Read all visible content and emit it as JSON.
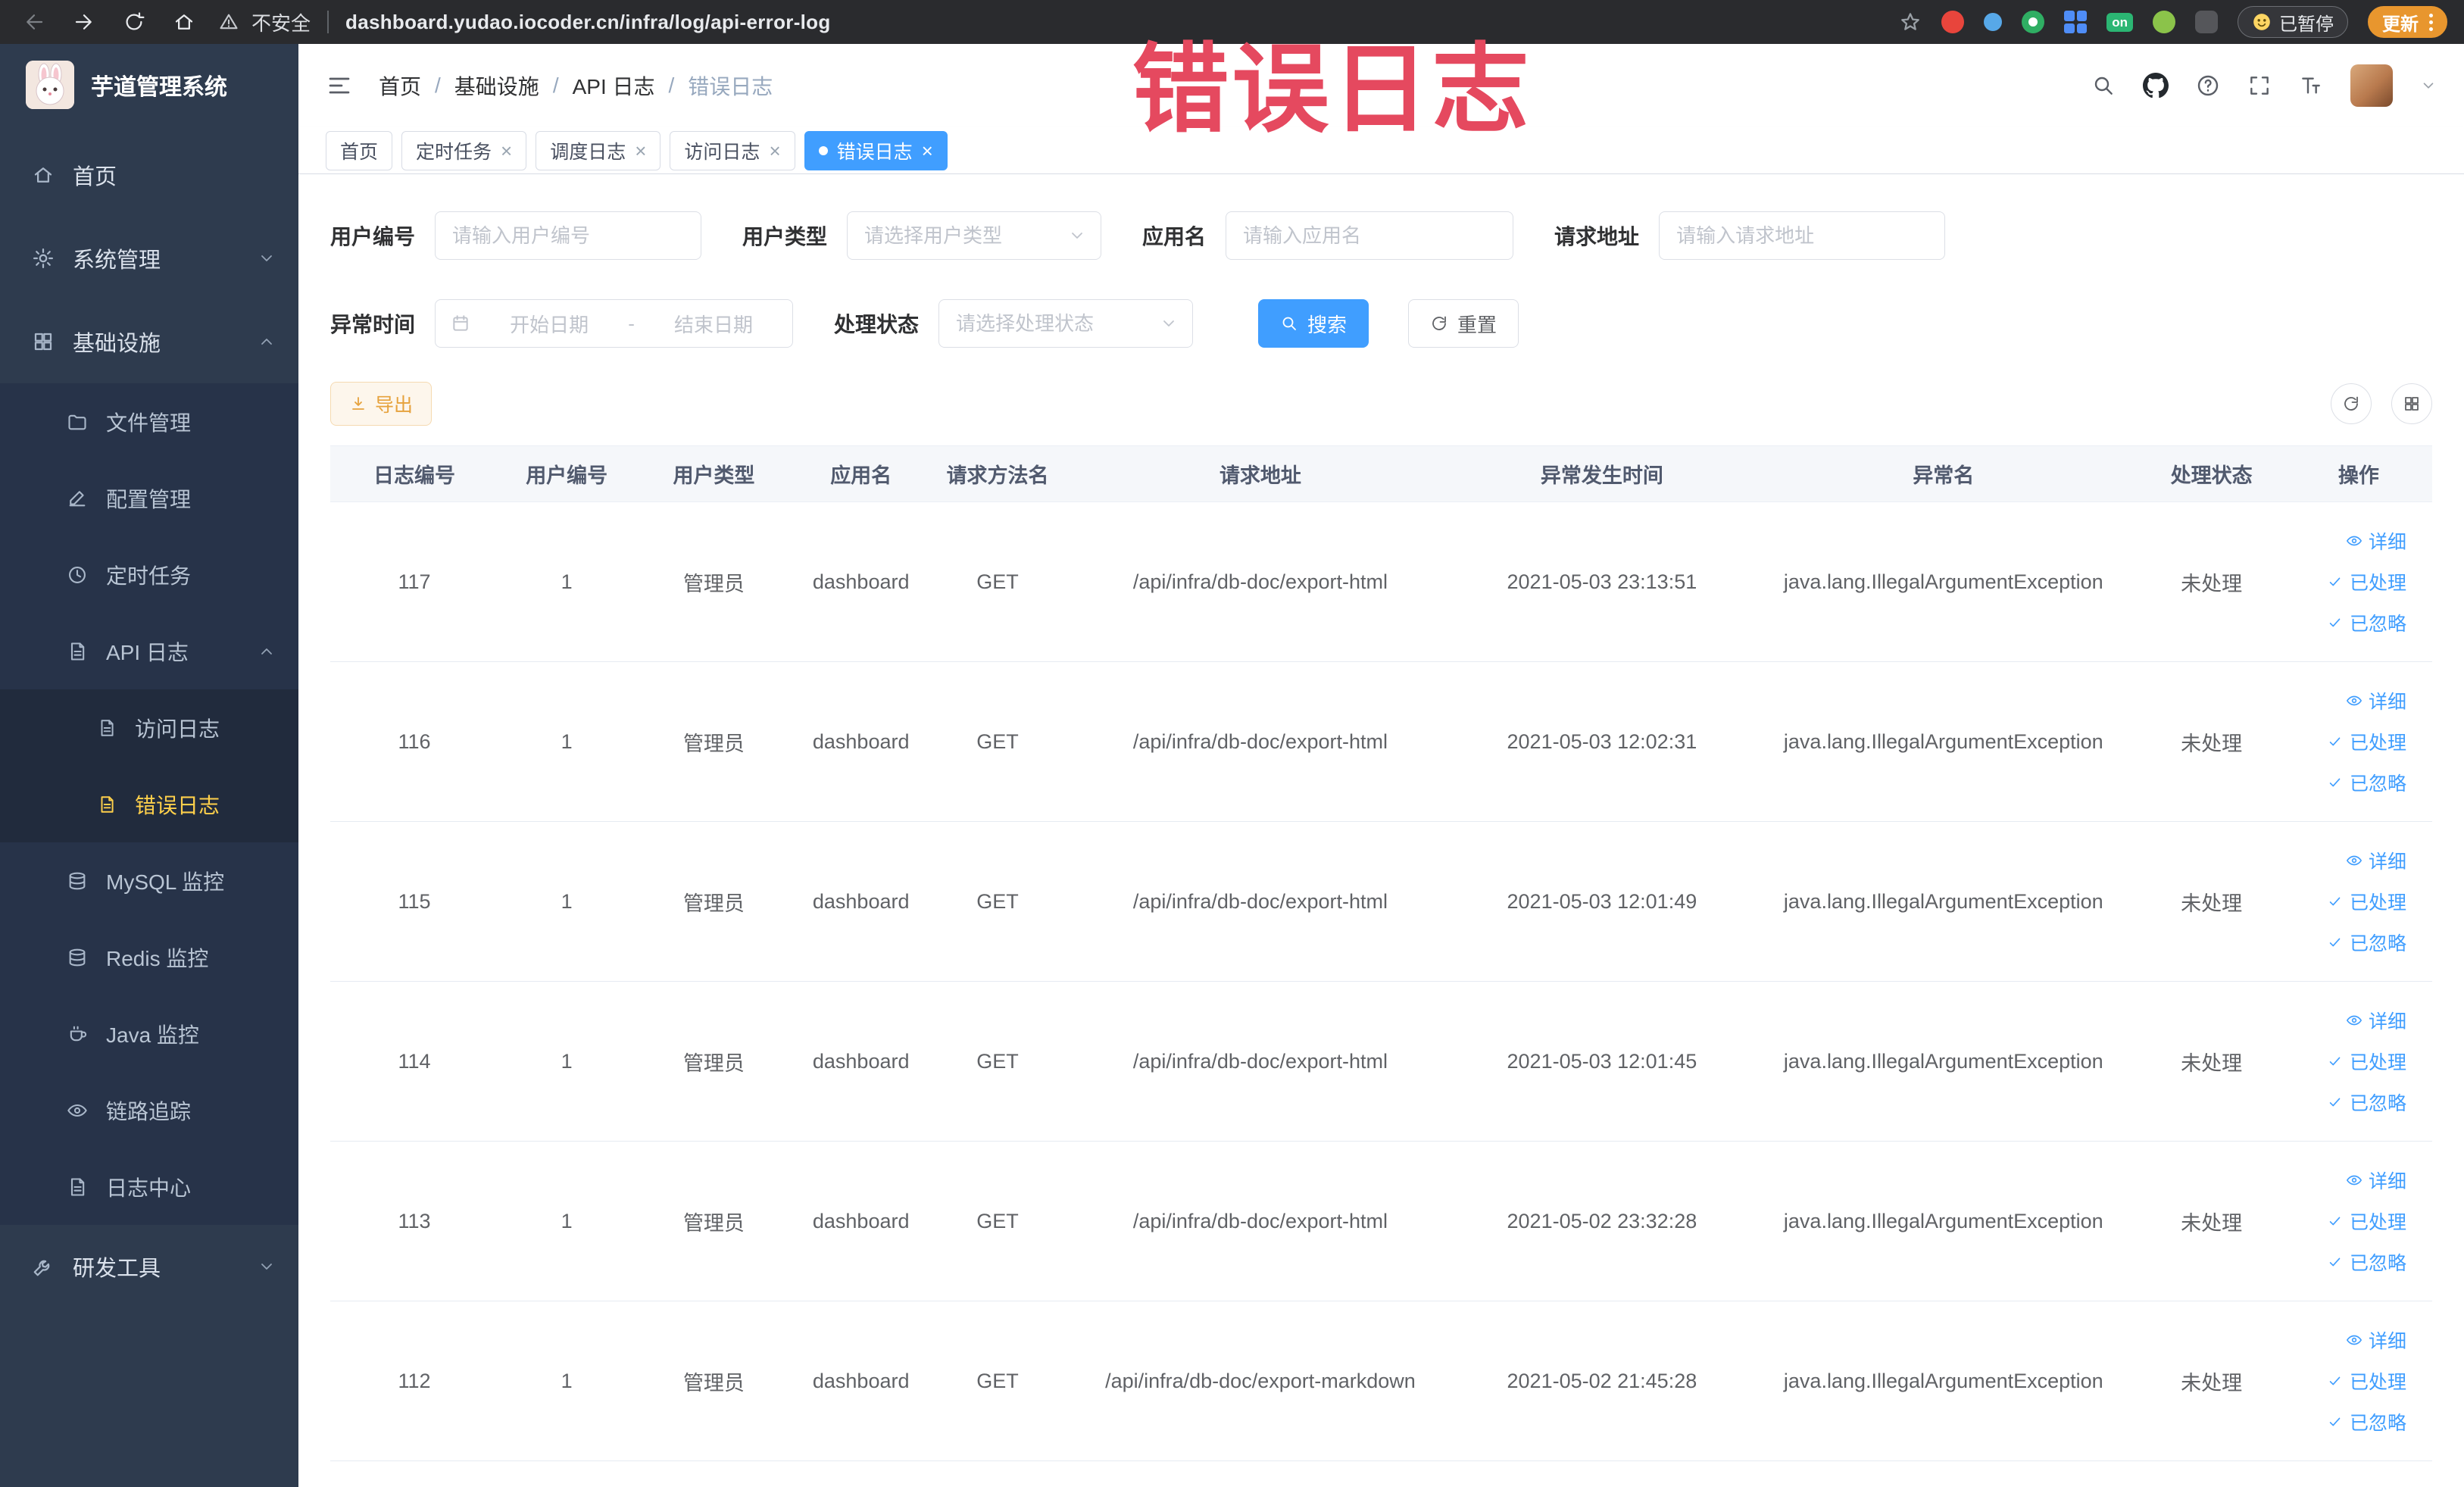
{
  "watermark": {
    "text": "错误日志"
  },
  "browser": {
    "security_label": "不安全",
    "url": "dashboard.yudao.iocoder.cn/infra/log/api-error-log",
    "on_badge": "on",
    "paused_label": "已暂停",
    "update_label": "更新"
  },
  "sidebar": {
    "logo_title": "芋道管理系统",
    "home": "首页",
    "system": "系统管理",
    "infra": "基础设施",
    "file_mgmt": "文件管理",
    "config_mgmt": "配置管理",
    "scheduled_jobs": "定时任务",
    "api_log": "API 日志",
    "access_log": "访问日志",
    "error_log": "错误日志",
    "mysql": "MySQL 监控",
    "redis": "Redis 监控",
    "java": "Java 监控",
    "tracing": "链路追踪",
    "log_center": "日志中心",
    "dev_tools": "研发工具"
  },
  "breadcrumb": {
    "separator": "/",
    "home": "首页",
    "infra": "基础设施",
    "api_log": "API 日志",
    "current": "错误日志"
  },
  "tabs": [
    {
      "label": "首页"
    },
    {
      "label": "定时任务"
    },
    {
      "label": "调度日志"
    },
    {
      "label": "访问日志"
    },
    {
      "label": "错误日志"
    }
  ],
  "filters": {
    "user_id": {
      "label": "用户编号",
      "placeholder": "请输入用户编号"
    },
    "user_type": {
      "label": "用户类型",
      "placeholder": "请选择用户类型"
    },
    "app_name": {
      "label": "应用名",
      "placeholder": "请输入应用名"
    },
    "request_url": {
      "label": "请求地址",
      "placeholder": "请输入请求地址"
    },
    "exception_time": {
      "label": "异常时间",
      "start_placeholder": "开始日期",
      "separator": "-",
      "end_placeholder": "结束日期"
    },
    "process_status": {
      "label": "处理状态",
      "placeholder": "请选择处理状态"
    },
    "search_label": "搜索",
    "reset_label": "重置"
  },
  "toolbar": {
    "export_label": "导出"
  },
  "table": {
    "columns": [
      "日志编号",
      "用户编号",
      "用户类型",
      "应用名",
      "请求方法名",
      "请求地址",
      "异常发生时间",
      "异常名",
      "处理状态",
      "操作"
    ],
    "actions": {
      "detail": "详细",
      "processed": "已处理",
      "ignored": "已忽略"
    },
    "rows": [
      {
        "id": "117",
        "user_id": "1",
        "user_type": "管理员",
        "app": "dashboard",
        "method": "GET",
        "url": "/api/infra/db-doc/export-html",
        "time": "2021-05-03 23:13:51",
        "exception": "java.lang.IllegalArgumentException",
        "status": "未处理"
      },
      {
        "id": "116",
        "user_id": "1",
        "user_type": "管理员",
        "app": "dashboard",
        "method": "GET",
        "url": "/api/infra/db-doc/export-html",
        "time": "2021-05-03 12:02:31",
        "exception": "java.lang.IllegalArgumentException",
        "status": "未处理"
      },
      {
        "id": "115",
        "user_id": "1",
        "user_type": "管理员",
        "app": "dashboard",
        "method": "GET",
        "url": "/api/infra/db-doc/export-html",
        "time": "2021-05-03 12:01:49",
        "exception": "java.lang.IllegalArgumentException",
        "status": "未处理"
      },
      {
        "id": "114",
        "user_id": "1",
        "user_type": "管理员",
        "app": "dashboard",
        "method": "GET",
        "url": "/api/infra/db-doc/export-html",
        "time": "2021-05-03 12:01:45",
        "exception": "java.lang.IllegalArgumentException",
        "status": "未处理"
      },
      {
        "id": "113",
        "user_id": "1",
        "user_type": "管理员",
        "app": "dashboard",
        "method": "GET",
        "url": "/api/infra/db-doc/export-html",
        "time": "2021-05-02 23:32:28",
        "exception": "java.lang.IllegalArgumentException",
        "status": "未处理"
      },
      {
        "id": "112",
        "user_id": "1",
        "user_type": "管理员",
        "app": "dashboard",
        "method": "GET",
        "url": "/api/infra/db-doc/export-markdown",
        "time": "2021-05-02 21:45:28",
        "exception": "java.lang.IllegalArgumentException",
        "status": "未处理"
      }
    ]
  },
  "colors": {
    "accent": "#409eff",
    "menu_active": "#ffd04b",
    "warning": "#e6a23c",
    "watermark": "#e5495f"
  }
}
